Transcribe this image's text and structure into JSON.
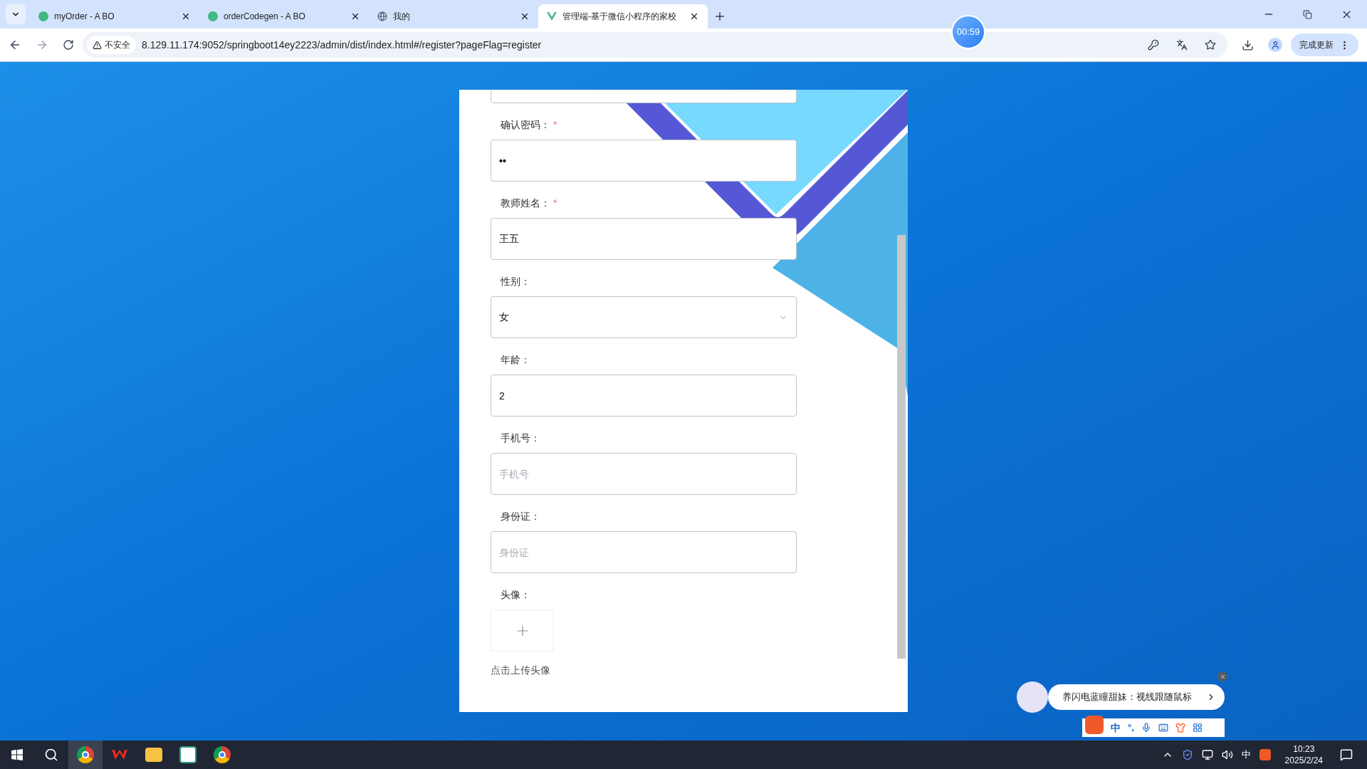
{
  "browser": {
    "tabs": [
      {
        "title": "myOrder - A BO",
        "kind": "vue-green",
        "selected": false
      },
      {
        "title": "orderCodegen - A BO",
        "kind": "vue-green",
        "selected": false
      },
      {
        "title": "我的",
        "kind": "globe",
        "selected": false
      },
      {
        "title": "管理端-基于微信小程序的家校",
        "kind": "vue",
        "selected": true
      }
    ],
    "security": "不安全",
    "url": "8.129.11.174:9052/springboot14ey2223/admin/dist/index.html#/register?pageFlag=register",
    "update_button": "完成更新"
  },
  "timer": "00:59",
  "form": {
    "fields": [
      {
        "label": "确认密码：",
        "required_mark": "*",
        "kind": "password",
        "value": "••"
      },
      {
        "label": "教师姓名：",
        "required_mark": "*",
        "kind": "text",
        "value": "王五"
      },
      {
        "label": "性别：",
        "kind": "select",
        "value": "女"
      },
      {
        "label": "年龄：",
        "kind": "text",
        "value": "2"
      },
      {
        "label": "手机号：",
        "kind": "text",
        "placeholder": "手机号"
      },
      {
        "label": "身份证：",
        "kind": "text",
        "placeholder": "身份证"
      }
    ],
    "avatar": {
      "label": "头像：",
      "hint": "点击上传头像"
    }
  },
  "ime_popup": {
    "message": "养闪电蓝瞳甜妹：视线跟随鼠标",
    "toolbar_mode": "中",
    "toolbar_punct": "°,"
  },
  "taskbar": {
    "ime": "中",
    "time": "10:23",
    "date": "2025/2/24"
  }
}
